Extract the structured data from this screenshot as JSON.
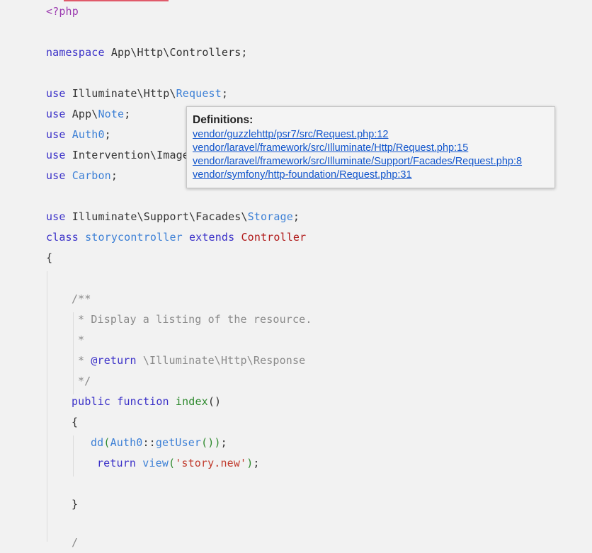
{
  "code": {
    "l1": {
      "php_tag": "<?php"
    },
    "l2": {
      "kw": "namespace",
      "rest": " App\\Http\\Controllers;"
    },
    "l3": {
      "kw": "use",
      "ns": " Illuminate\\Http\\",
      "cls": "Request",
      "end": ";"
    },
    "l4": {
      "kw": "use",
      "ns": " App\\",
      "cls": "Note",
      "end": ";"
    },
    "l5": {
      "kw": "use",
      "cls": "Auth0",
      "end": ";"
    },
    "l6": {
      "kw": "use",
      "rest": " Intervention\\Image"
    },
    "l7": {
      "kw": "use",
      "cls": "Carbon",
      "end": ";"
    },
    "l8": {
      "kw": "use",
      "ns": " Illuminate\\Support\\Facades\\",
      "cls": "Storage",
      "end": ";"
    },
    "l9": {
      "kw1": "class",
      "cls": "storycontroller",
      "kw2": "extends",
      "parent": "Controller"
    },
    "l10": {
      "brace": "{"
    },
    "l11": {
      "cmt": "/**"
    },
    "l12": {
      "cmt": "* Display a listing of the resource."
    },
    "l13": {
      "cmt": "*"
    },
    "l14": {
      "star": "* ",
      "tag": "@return",
      "cmt": " \\Illuminate\\Http\\Response"
    },
    "l15": {
      "cmt": "*/"
    },
    "l16": {
      "kw1": "public",
      "kw2": "function",
      "fn": "index",
      "paren": "()"
    },
    "l17": {
      "brace": "{"
    },
    "l18": {
      "fn": "dd",
      "p1": "(",
      "cls": "Auth0",
      "op": "::",
      "method": "getUser",
      "p2": "())",
      "end": ";"
    },
    "l19": {
      "kw": "return",
      "fn": "view",
      "p1": "(",
      "str": "'story.new'",
      "p2": ")",
      "end": ";"
    },
    "l20": {
      "brace": "}"
    },
    "l21": {
      "cmt": "/"
    }
  },
  "popup": {
    "title": "Definitions:",
    "links": [
      "vendor/guzzlehttp/psr7/src/Request.php:12",
      "vendor/laravel/framework/src/Illuminate/Http/Request.php:15",
      "vendor/laravel/framework/src/Illuminate/Support/Facades/Request.php:8",
      "vendor/symfony/http-foundation/Request.php:31"
    ]
  },
  "colors": {
    "keyword": "#3a30c8",
    "class": "#3d80d6",
    "php_tag": "#9c3bb0",
    "parent_class": "#b01818",
    "function": "#2f8a2f",
    "string": "#c0392b",
    "comment": "#8a8a8a",
    "link": "#1155cc",
    "background": "#f2f2f2"
  }
}
